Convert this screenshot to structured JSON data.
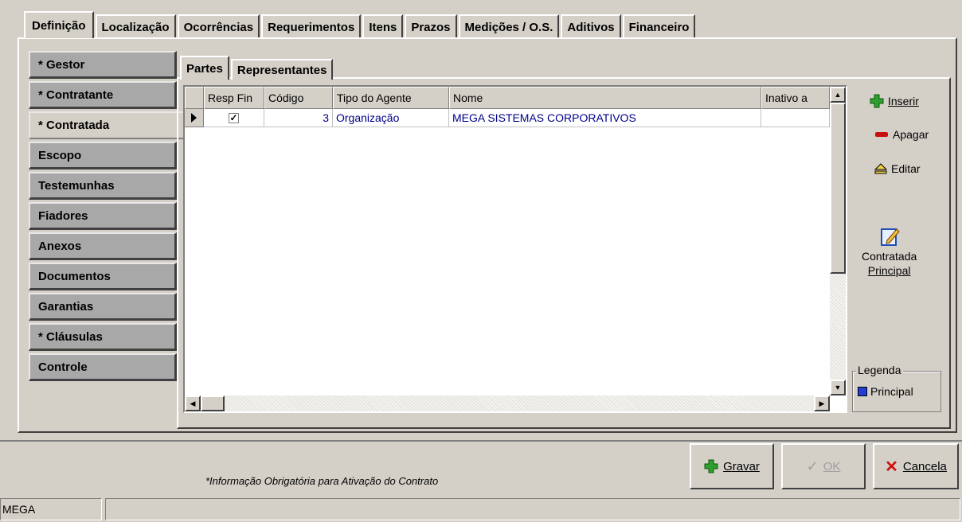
{
  "top_tabs": [
    "Definição",
    "Localização",
    "Ocorrências",
    "Requerimentos",
    "Itens",
    "Prazos",
    "Medições / O.S.",
    "Aditivos",
    "Financeiro"
  ],
  "side_nav": [
    "* Gestor",
    "* Contratante",
    "* Contratada",
    "Escopo",
    "Testemunhas",
    "Fiadores",
    "Anexos",
    "Documentos",
    "Garantias",
    "* Cláusulas",
    "Controle"
  ],
  "sub_tabs": [
    "Partes",
    "Representantes"
  ],
  "grid": {
    "columns": [
      "Resp Fin",
      "Código",
      "Tipo do Agente",
      "Nome",
      "Inativo a"
    ],
    "rows": [
      {
        "resp_fin": "✓",
        "codigo": "3",
        "tipo": "Organização",
        "nome": "MEGA SISTEMAS CORPORATIVOS",
        "inativo": ""
      }
    ]
  },
  "actions": {
    "inserir": "Inserir",
    "apagar": "Apagar",
    "editar": "Editar",
    "principal_1": "Contratada",
    "principal_2": "Principal"
  },
  "legend": {
    "title": "Legenda",
    "item": "Principal",
    "color": "#1f3fd8"
  },
  "note": "*Informação Obrigatória para Ativação do Contrato",
  "buttons": {
    "gravar": "Gravar",
    "ok": "OK",
    "cancela": "Cancela"
  },
  "status": {
    "user": "MEGA"
  }
}
